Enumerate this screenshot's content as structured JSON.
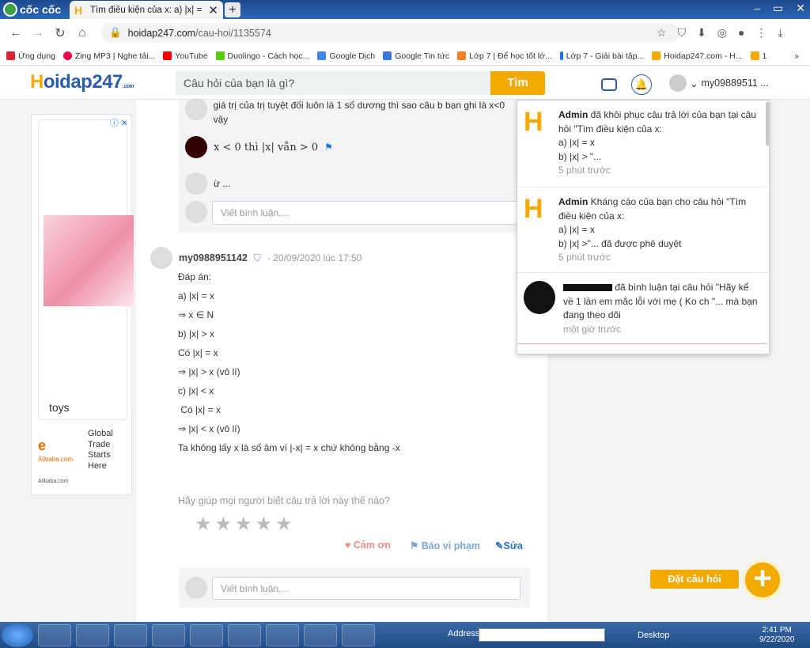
{
  "browser": {
    "brand": "cốc cốc",
    "tab_title": "Tìm điều kiện của x: a) |x| = x",
    "new_tab": "+",
    "url_domain": "hoidap247.com",
    "url_path": "/cau-hoi/1135574",
    "bookmarks": [
      "Ứng dụng",
      "Zing MP3 | Nghe tải...",
      "YouTube",
      "Duolingo - Cách học...",
      "Google Dịch",
      "Google Tin tức",
      "Lớp 7 | Để học tốt lớ...",
      "Lớp 7 - Giải bài tập...",
      "Hoidap247.com - H...",
      "1"
    ],
    "bookmarks_more": "»"
  },
  "site": {
    "logo_h": "H",
    "logo_rest": "oidap247",
    "logo_sub": ".com",
    "search_placeholder": "Câu hỏi của bạn là gì?",
    "search_button": "Tìm",
    "username": "my09889511 ..."
  },
  "ad": {
    "label": "toys",
    "brand": "Alibaba",
    "brand_sub": "Alibaba.com",
    "tagline": "Global Trade Starts Here",
    "footer": "Alibaba.com"
  },
  "comments": {
    "top_text": "giá trị của trị tuyệt đối luôn là 1 số dương thì sao câu b bạn ghi là x<0 vậy",
    "reply_text": "x < 0 thì |x| vẫn > 0",
    "reply2": "ừ ...",
    "input_placeholder": "Viết bình luận...."
  },
  "answer": {
    "author": "my0988951142",
    "time": "- 20/09/2020 lúc 17:50",
    "lines": [
      "Đáp án:",
      "a) |x| = x",
      "⇒ x ∈ N",
      "b) |x| > x",
      "Có |x| = x",
      "⇒ |x| > x (vô lí)",
      "c) |x| < x",
      " Có |x| = x",
      "⇒ |x| < x (vô lí)",
      "Ta không lấy x là số âm vì |-x| = x chứ không bằng -x"
    ],
    "help_text": "Hãy giúp mọi người biết câu trả lời này thế nào?",
    "rating": 0,
    "thanks": "Cảm ơn",
    "report": "Báo vi phạm",
    "edit": "Sửa"
  },
  "ask_button": "Đặt câu hỏi",
  "notifications": [
    {
      "who": "Admin",
      "text": " đã khôi phục câu trả lời của bạn tại câu hỏi \"Tìm điều kiện của x:",
      "line2": "a) |x| = x",
      "line3": "b) |x| > \"...",
      "ago": "5 phút trước"
    },
    {
      "who": "Admin",
      "text": " Kháng cáo của bạn cho câu hỏi \"Tìm điều kiện của x:",
      "line2": "a) |x| = x",
      "line3": "b) |x| >\"... đã được phê duyệt",
      "ago": "5 phút trước"
    },
    {
      "who": "",
      "text": "đã bình luận tại câu hỏi \"Hãy kể về 1 lần em mắc lỗi với mẹ ( Ko ch \"... mà bạn đang theo dõi",
      "line2": "",
      "line3": "",
      "ago": "một giờ trước"
    }
  ],
  "taskbar": {
    "address_label": "Address",
    "desktop_label": "Desktop",
    "time": "2:41 PM",
    "date": "9/22/2020"
  }
}
